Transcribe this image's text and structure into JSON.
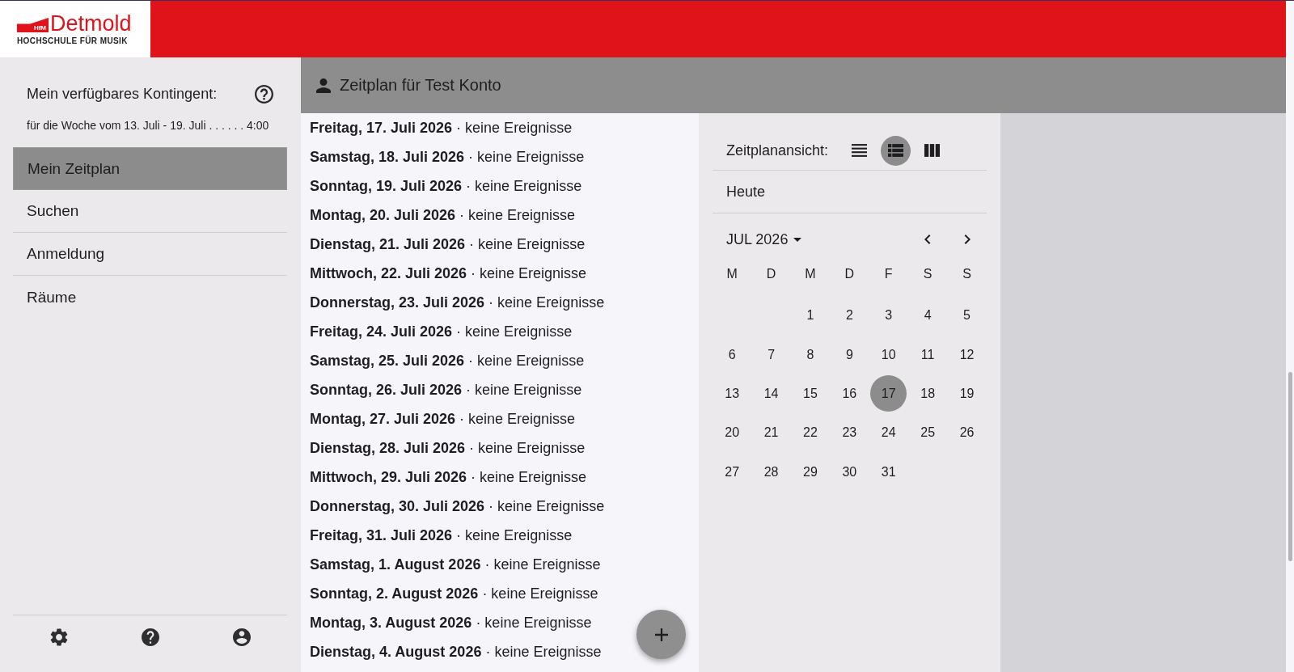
{
  "logo": {
    "badge": "HfM",
    "name": "Detmold",
    "subtitle": "HOCHSCHULE FÜR MUSIK"
  },
  "sidebar": {
    "quota": {
      "title": "Mein verfügbares Kontingent:",
      "week": "für die Woche vom 13. Juli - 19. Juli . . . . . . 4:00"
    },
    "items": [
      {
        "label": "Mein Zeitplan",
        "selected": true
      },
      {
        "label": "Suchen",
        "selected": false
      },
      {
        "label": "Anmeldung",
        "selected": false
      },
      {
        "label": "Räume",
        "selected": false
      }
    ]
  },
  "header": {
    "title": "Zeitplan für Test Konto"
  },
  "schedule": {
    "entries": [
      "**Freitag, 17. Juli 2026** · keine Ereignisse",
      "**Samstag, 18. Juli 2026** · keine Ereignisse",
      "**Sonntag, 19. Juli 2026** · keine Ereignisse",
      "**Montag, 20. Juli 2026** · keine Ereignisse",
      "**Dienstag, 21. Juli 2026** · keine Ereignisse",
      "**Mittwoch, 22. Juli 2026** · keine Ereignisse",
      "**Donnerstag, 23. Juli 2026** · keine Ereignisse",
      "**Freitag, 24. Juli 2026** · keine Ereignisse",
      "**Samstag, 25. Juli 2026** · keine Ereignisse",
      "**Sonntag, 26. Juli 2026** · keine Ereignisse",
      "**Montag, 27. Juli 2026** · keine Ereignisse",
      "**Dienstag, 28. Juli 2026** · keine Ereignisse",
      "**Mittwoch, 29. Juli 2026** · keine Ereignisse",
      "**Donnerstag, 30. Juli 2026** · keine Ereignisse",
      "**Freitag, 31. Juli 2026** · keine Ereignisse",
      "**Samstag, 1. August 2026** · keine Ereignisse",
      "**Sonntag, 2. August 2026** · keine Ereignisse",
      "**Montag, 3. August 2026** · keine Ereignisse",
      "**Dienstag, 4. August 2026** · keine Ereignisse"
    ]
  },
  "calendar_panel": {
    "view_label": "Zeitplanansicht:",
    "view_modes": [
      {
        "kind": "lines",
        "selected": false
      },
      {
        "kind": "list",
        "selected": true
      },
      {
        "kind": "columns",
        "selected": false
      }
    ],
    "today_button": "Heute",
    "month": "JUL 2026",
    "weekdays": [
      "M",
      "D",
      "M",
      "D",
      "F",
      "S",
      "S"
    ],
    "weeks": [
      {
        "days": [
          {
            "label": "1",
            "selected": false
          },
          {
            "label": "2",
            "selected": false
          },
          {
            "label": "3",
            "selected": false
          },
          {
            "label": "4",
            "selected": false
          },
          {
            "label": "5",
            "selected": false
          }
        ]
      },
      {
        "days": [
          {
            "label": "6",
            "selected": false
          },
          {
            "label": "7",
            "selected": false
          },
          {
            "label": "8",
            "selected": false
          },
          {
            "label": "9",
            "selected": false
          },
          {
            "label": "10",
            "selected": false
          },
          {
            "label": "11",
            "selected": false
          },
          {
            "label": "12",
            "selected": false
          }
        ]
      },
      {
        "days": [
          {
            "label": "13",
            "selected": false
          },
          {
            "label": "14",
            "selected": false
          },
          {
            "label": "15",
            "selected": false
          },
          {
            "label": "16",
            "selected": false
          },
          {
            "label": "17",
            "selected": true
          },
          {
            "label": "18",
            "selected": false
          },
          {
            "label": "19",
            "selected": false
          }
        ]
      },
      {
        "days": [
          {
            "label": "20",
            "selected": false
          },
          {
            "label": "21",
            "selected": false
          },
          {
            "label": "22",
            "selected": false
          },
          {
            "label": "23",
            "selected": false
          },
          {
            "label": "24",
            "selected": false
          },
          {
            "label": "25",
            "selected": false
          },
          {
            "label": "26",
            "selected": false
          }
        ]
      },
      {
        "days": [
          {
            "label": "27",
            "selected": false
          },
          {
            "label": "28",
            "selected": false
          },
          {
            "label": "29",
            "selected": false
          },
          {
            "label": "30",
            "selected": false
          },
          {
            "label": "31",
            "selected": false
          }
        ]
      }
    ]
  }
}
